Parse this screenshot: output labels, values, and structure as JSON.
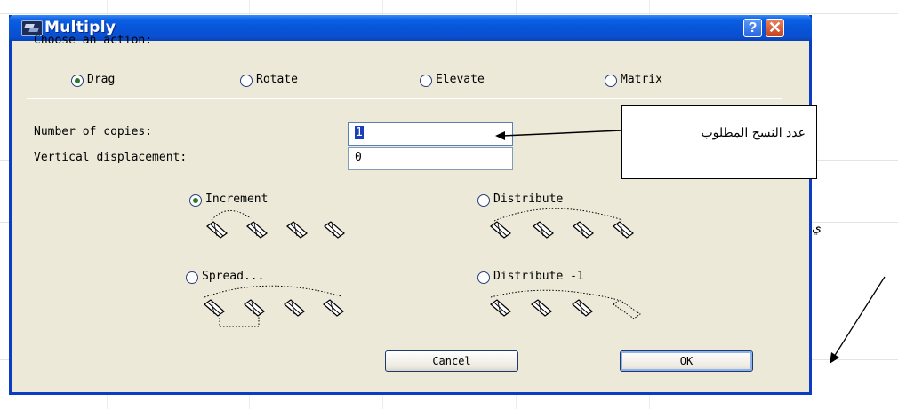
{
  "window": {
    "title": "Multiply",
    "help_label": "?",
    "close_label": "✕"
  },
  "action": {
    "heading": "Choose an action:",
    "options": [
      {
        "label": "Drag",
        "selected": true
      },
      {
        "label": "Rotate",
        "selected": false
      },
      {
        "label": "Elevate",
        "selected": false
      },
      {
        "label": "Matrix",
        "selected": false
      }
    ]
  },
  "fields": {
    "copies_label": "Number of copies:",
    "copies_value": "1",
    "vertical_label": "Vertical displacement:",
    "vertical_value": "0"
  },
  "modes": [
    {
      "label": "Increment",
      "selected": true
    },
    {
      "label": "Distribute",
      "selected": false
    },
    {
      "label": "Spread...",
      "selected": false
    },
    {
      "label": "Distribute -1",
      "selected": false
    }
  ],
  "buttons": {
    "cancel": "Cancel",
    "ok": "OK"
  },
  "annotation": {
    "callout_text": "عدد النسخ المطلوب",
    "side_mark": "ي"
  },
  "colors": {
    "titlebar": "#0854d8",
    "dialog_bg": "#ece9d8",
    "radio_dot": "#2a7a2a",
    "selection": "#1b3fb8"
  }
}
